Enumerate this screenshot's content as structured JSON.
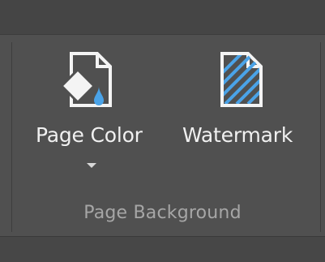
{
  "ribbon": {
    "group_label": "Page Background",
    "buttons": [
      {
        "label": "Page Color",
        "icon": "page-color-icon",
        "has_dropdown": true
      },
      {
        "label": "Watermark",
        "icon": "watermark-icon",
        "has_dropdown": false
      }
    ]
  },
  "colors": {
    "background": "#505050",
    "text": "#f0f0f0",
    "group_label": "#a6a6a6",
    "accent_blue": "#4aa3e8"
  }
}
